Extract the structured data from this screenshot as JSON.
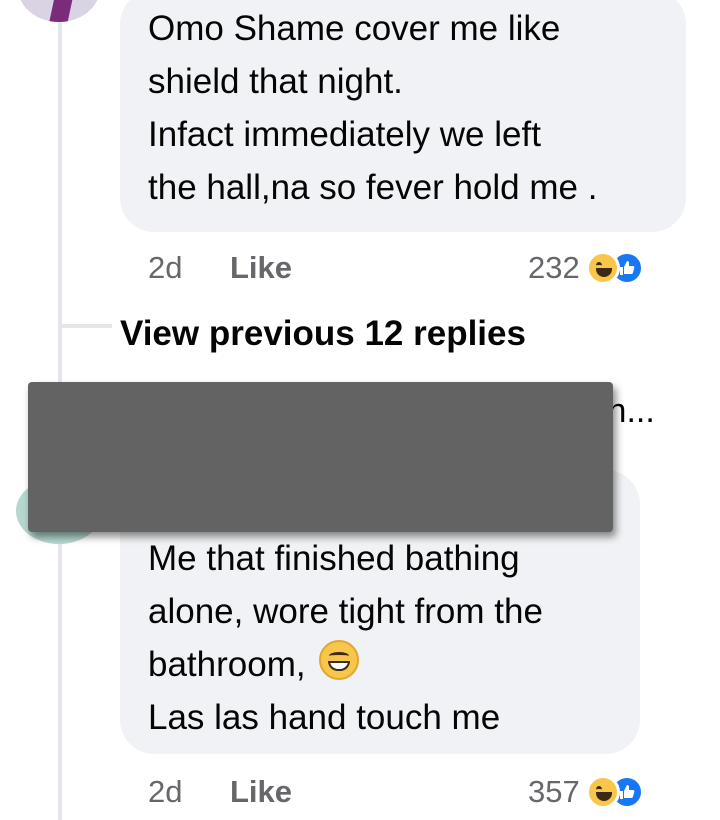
{
  "comment1": {
    "lines": [
      "Omo Shame cover me like",
      "shield that night.",
      "Infact immediately  we left",
      "the hall,na so fever hold me ."
    ],
    "time": "2d",
    "like_label": "Like",
    "reaction_count": "232",
    "reactions": [
      "haha-reaction-icon",
      "like-reaction-icon"
    ]
  },
  "view_previous": "View previous 12 replies",
  "truncated_text": "ih...",
  "comment2": {
    "lines": [
      "Me that finished bathing",
      "alone, wore  tight from the",
      "bathroom,",
      "Las las hand touch me"
    ],
    "inline_emoji": "grinning-face-icon",
    "time": "2d",
    "like_label": "Like",
    "reaction_count": "357",
    "reactions": [
      "haha-reaction-icon",
      "like-reaction-icon"
    ]
  },
  "colors": {
    "bubble": "#f0f2f5",
    "meta_text": "#65676b",
    "like_blue": "#1877f2",
    "redaction": "#636363"
  }
}
